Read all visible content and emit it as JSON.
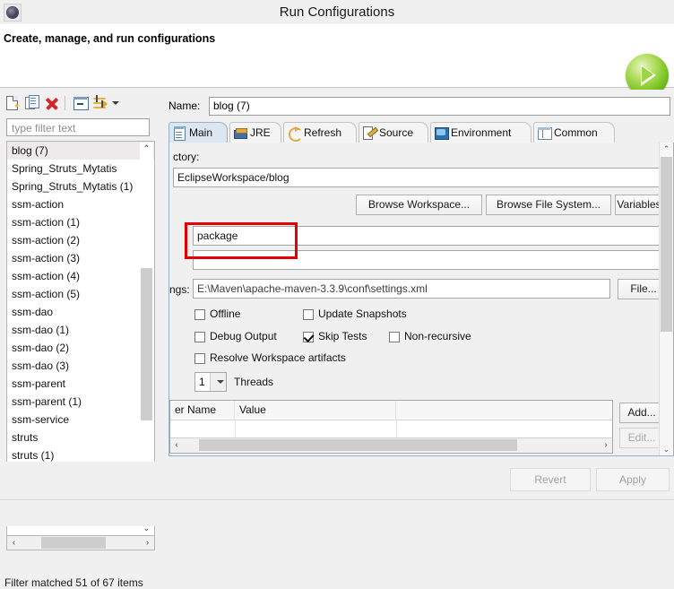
{
  "window": {
    "title": "Run Configurations",
    "icon": "eclipse-launch-icon"
  },
  "header": {
    "title": "Create, manage, and run configurations",
    "run_icon": "green-run-play-icon"
  },
  "left_panel": {
    "toolbar": [
      {
        "name": "new-launch-configuration-icon",
        "label": "New launch configuration"
      },
      {
        "name": "duplicate-launch-configuration-icon",
        "label": "Duplicate"
      },
      {
        "name": "delete-launch-configuration-icon",
        "label": "Delete"
      },
      {
        "name": "collapse-all-icon",
        "label": "Collapse All"
      },
      {
        "name": "filter-launch-configurations-icon",
        "label": "Filter"
      },
      {
        "name": "view-menu-chevron-down-icon",
        "label": "View Menu"
      }
    ],
    "filter": {
      "placeholder": "type filter text",
      "value": ""
    },
    "items": [
      {
        "label": "blog (7)",
        "selected": true
      },
      {
        "label": "Spring_Struts_Mytatis",
        "selected": false
      },
      {
        "label": "Spring_Struts_Mytatis (1)",
        "selected": false
      },
      {
        "label": "ssm-action",
        "selected": false
      },
      {
        "label": "ssm-action (1)",
        "selected": false
      },
      {
        "label": "ssm-action (2)",
        "selected": false
      },
      {
        "label": "ssm-action (3)",
        "selected": false
      },
      {
        "label": "ssm-action (4)",
        "selected": false
      },
      {
        "label": "ssm-action (5)",
        "selected": false
      },
      {
        "label": "ssm-dao",
        "selected": false
      },
      {
        "label": "ssm-dao (1)",
        "selected": false
      },
      {
        "label": "ssm-dao (2)",
        "selected": false
      },
      {
        "label": "ssm-dao (3)",
        "selected": false
      },
      {
        "label": "ssm-parent",
        "selected": false
      },
      {
        "label": "ssm-parent (1)",
        "selected": false
      },
      {
        "label": "ssm-service",
        "selected": false
      },
      {
        "label": "struts",
        "selected": false
      },
      {
        "label": "struts (1)",
        "selected": false
      }
    ],
    "status": "Filter matched 51 of 67 items",
    "scroll_up_glyph": "⌃",
    "scroll_down_glyph": "⌄",
    "scroll_left_glyph": "‹",
    "scroll_right_glyph": "›"
  },
  "right_panel": {
    "name_label": "Name:",
    "name_value": "blog (7)",
    "tabs": [
      {
        "label": "Main",
        "icon": "main-document-icon",
        "active": true
      },
      {
        "label": "JRE",
        "icon": "jre-library-icon",
        "active": false
      },
      {
        "label": "Refresh",
        "icon": "refresh-arrows-icon",
        "active": false
      },
      {
        "label": "Source",
        "icon": "source-pencil-icon",
        "active": false
      },
      {
        "label": "Environment",
        "icon": "environment-monitor-icon",
        "active": false
      },
      {
        "label": "Common",
        "icon": "common-panel-icon",
        "active": false
      }
    ],
    "main_tab": {
      "base_directory_label": "ctory:",
      "base_directory_value": "EclipseWorkspace/blog",
      "browse_workspace_button": "Browse Workspace...",
      "browse_file_system_button": "Browse File System...",
      "variables_button": "Variables...",
      "goals_value": "package",
      "profiles_value": "",
      "settings_label": "ngs:",
      "settings_value": "E:\\Maven\\apache-maven-3.3.9\\conf\\settings.xml",
      "settings_file_button": "File...",
      "checkboxes": [
        {
          "label": "Offline",
          "checked": false
        },
        {
          "label": "Update Snapshots",
          "checked": false
        },
        {
          "label": "Debug Output",
          "checked": false
        },
        {
          "label": "Skip Tests",
          "checked": true
        },
        {
          "label": "Non-recursive",
          "checked": false
        },
        {
          "label": "Resolve Workspace artifacts",
          "checked": false
        }
      ],
      "threads_value": "1",
      "threads_label": "Threads",
      "parameters_table": {
        "columns": [
          "er Name",
          "Value"
        ],
        "rows": []
      },
      "add_button": "Add...",
      "edit_button": "Edit...",
      "scroll_up_glyph": "⌃",
      "scroll_down_glyph": "⌄",
      "scroll_left_glyph": "‹",
      "scroll_right_glyph": "›"
    }
  },
  "footer": {
    "revert_button": "Revert",
    "apply_button": "Apply"
  },
  "annotation": {
    "name": "red-highlight-box",
    "color": "#e50000",
    "targets": "goals-input"
  }
}
